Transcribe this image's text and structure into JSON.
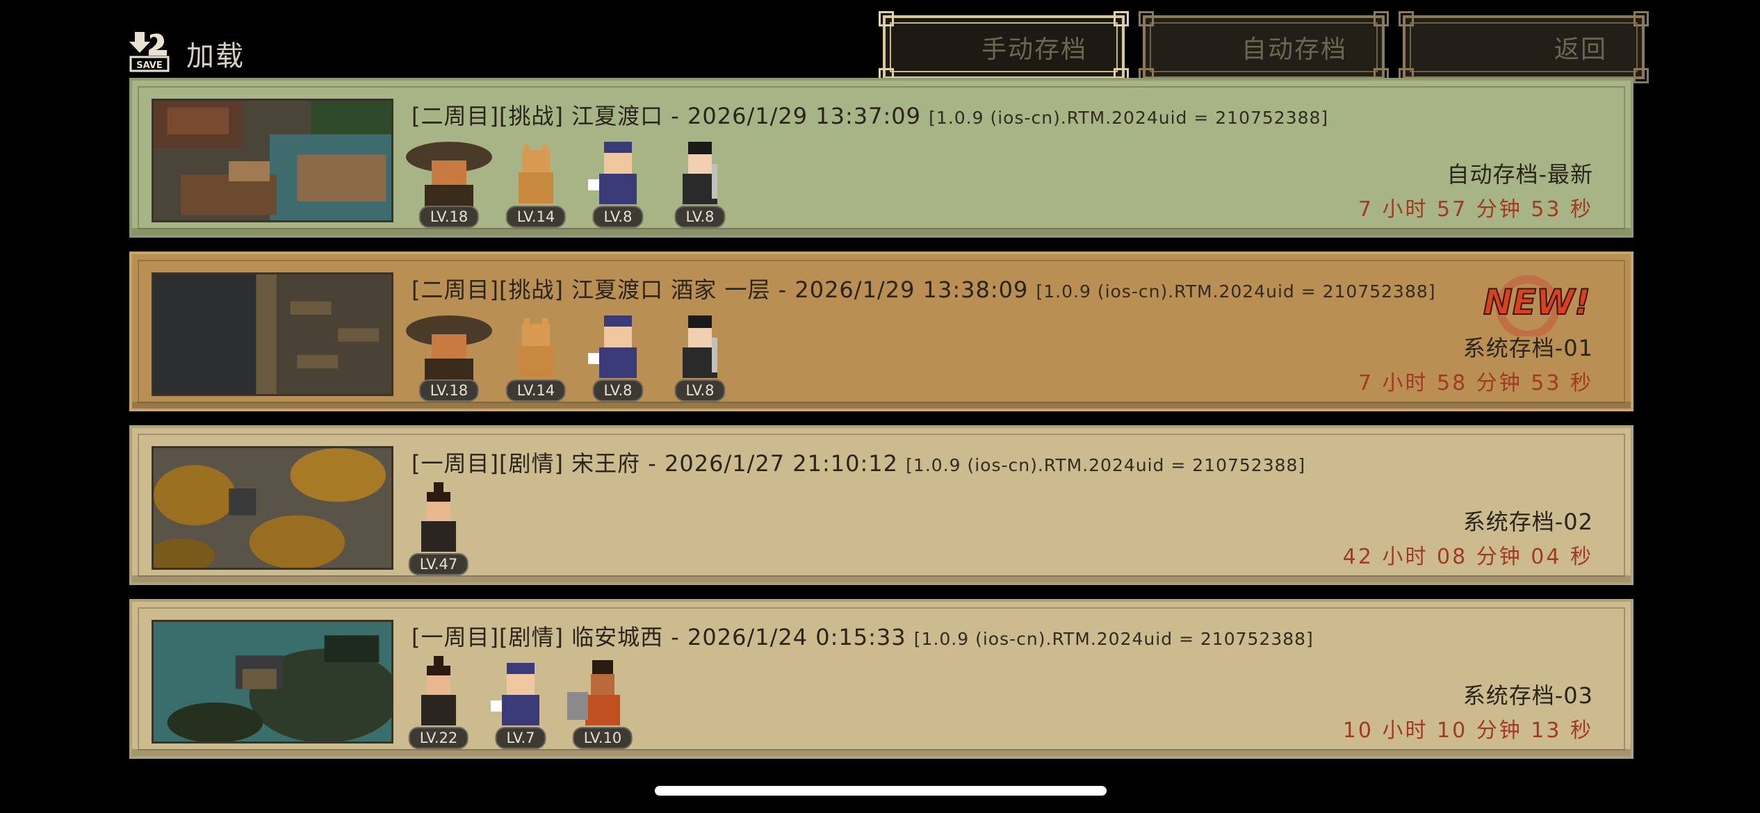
{
  "header": {
    "title": "加载",
    "icon": "save-icon",
    "icon_label": "SAVE"
  },
  "tabs": [
    {
      "label": "手动存档",
      "active": true
    },
    {
      "label": "自动存档",
      "active": false
    },
    {
      "label": "返回",
      "active": false
    }
  ],
  "slots": [
    {
      "title": "[二周目][挑战] 江夏渡口 - 2026/1/29 13:37:09",
      "meta": "[1.0.9 (ios-cn).RTM.2024uid = 210752388]",
      "name": "自动存档-最新",
      "playtime": "7 小时 57 分钟 53 秒",
      "color": "#a7b486",
      "party": [
        "LV.18",
        "LV.14",
        "LV.8",
        "LV.8"
      ]
    },
    {
      "title": "[二周目][挑战] 江夏渡口 酒家 一层 - 2026/1/29 13:38:09",
      "meta": "[1.0.9 (ios-cn).RTM.2024uid = 210752388]",
      "name": "系统存档-01",
      "playtime": "7 小时 58 分钟 53 秒",
      "badge": "NEW!",
      "color": "#b98f54",
      "party": [
        "LV.18",
        "LV.14",
        "LV.8",
        "LV.8"
      ]
    },
    {
      "title": "[一周目][剧情] 宋王府 - 2026/1/27 21:10:12",
      "meta": "[1.0.9 (ios-cn).RTM.2024uid = 210752388]",
      "name": "系统存档-02",
      "playtime": "42 小时 08 分钟 04 秒",
      "color": "#ccbb8f",
      "party": [
        "LV.47"
      ]
    },
    {
      "title": "[一周目][剧情] 临安城西 - 2026/1/24 0:15:33",
      "meta": "[1.0.9 (ios-cn).RTM.2024uid = 210752388]",
      "name": "系统存档-03",
      "playtime": "10 小时 10 分钟 13 秒",
      "color": "#ccbb8f",
      "party": [
        "LV.22",
        "LV.7",
        "LV.10"
      ]
    }
  ]
}
